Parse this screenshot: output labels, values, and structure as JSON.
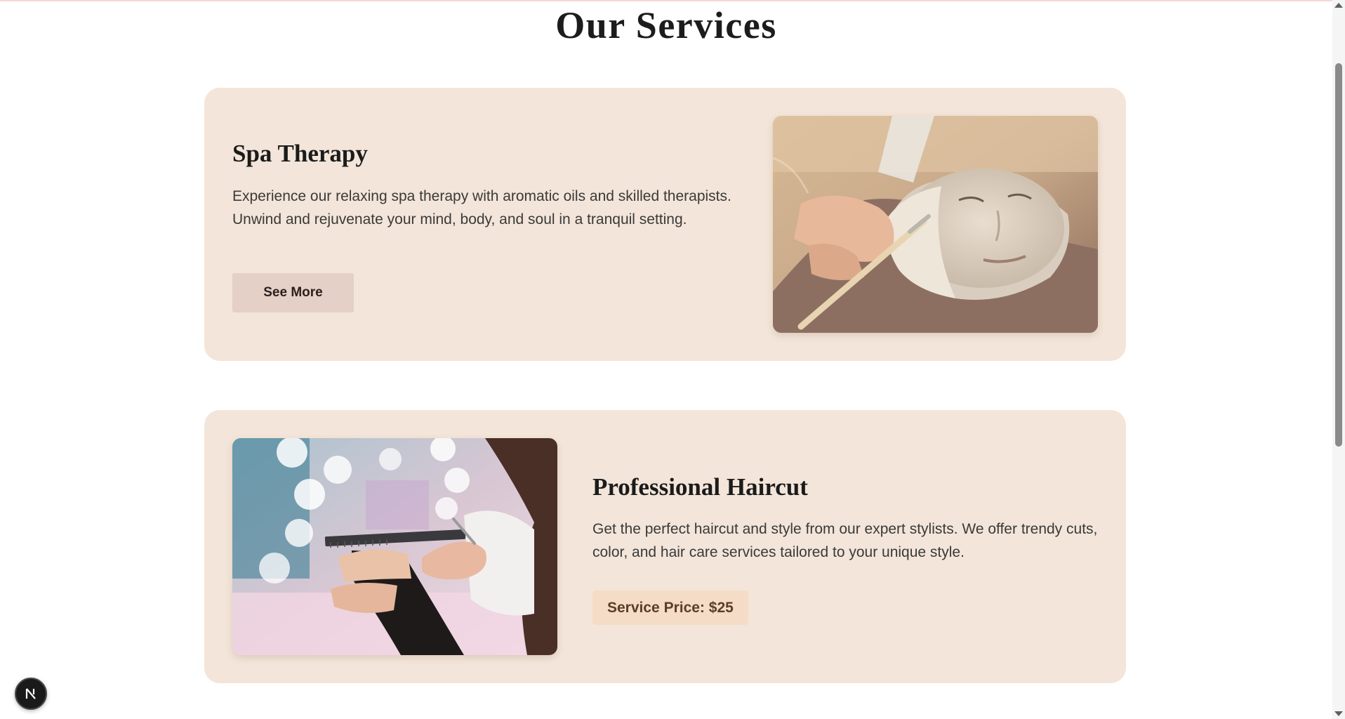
{
  "page": {
    "title": "Our Services"
  },
  "services": [
    {
      "heading": "Spa Therapy",
      "description": "Experience our relaxing spa therapy with aromatic oils and skilled therapists. Unwind and rejuvenate your mind, body, and soul in a tranquil setting.",
      "button_label": "See More",
      "image": "facial-mask-treatment-photo"
    },
    {
      "heading": "Professional Haircut",
      "description": "Get the perfect haircut and style from our expert stylists. We offer trendy cuts, color, and hair care services tailored to your unique style.",
      "price_label": "Service Price: $25",
      "image": "haircut-scissors-comb-photo"
    }
  ],
  "dev_badge": {
    "icon": "nextjs-logo-icon"
  },
  "colors": {
    "card_background": "#f3e5d9",
    "button_background": "#e4d0c6",
    "price_badge_background": "#f5dcc6",
    "price_text": "#5c3e26",
    "heading_text": "#1b1b1b",
    "body_text": "#3a3a3a"
  }
}
